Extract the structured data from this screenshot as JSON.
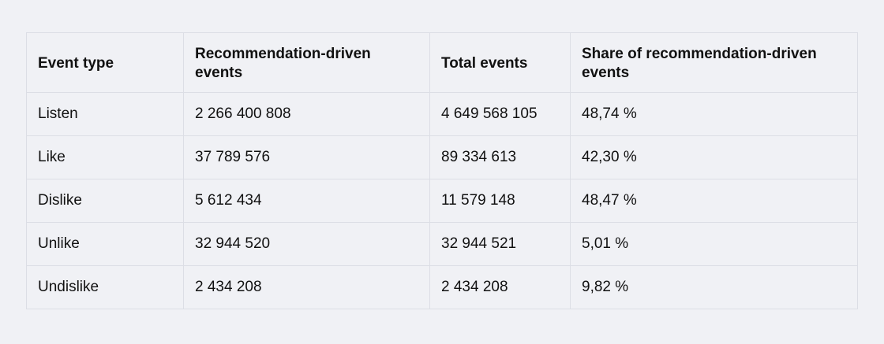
{
  "table": {
    "columns": [
      "Event type",
      "Recommendation-driven events",
      "Total events",
      "Share of recommendation-driven events"
    ],
    "rows": [
      [
        "Listen",
        "2 266 400 808",
        "4 649 568 105",
        "48,74 %"
      ],
      [
        "Like",
        "37 789 576",
        "89 334 613",
        "42,30 %"
      ],
      [
        "Dislike",
        "5 612 434",
        "11 579 148",
        "48,47 %"
      ],
      [
        "Unlike",
        "32 944 520",
        "32 944 521",
        "5,01 %"
      ],
      [
        "Undislike",
        "2 434 208",
        "2 434 208",
        "9,82 %"
      ]
    ]
  }
}
